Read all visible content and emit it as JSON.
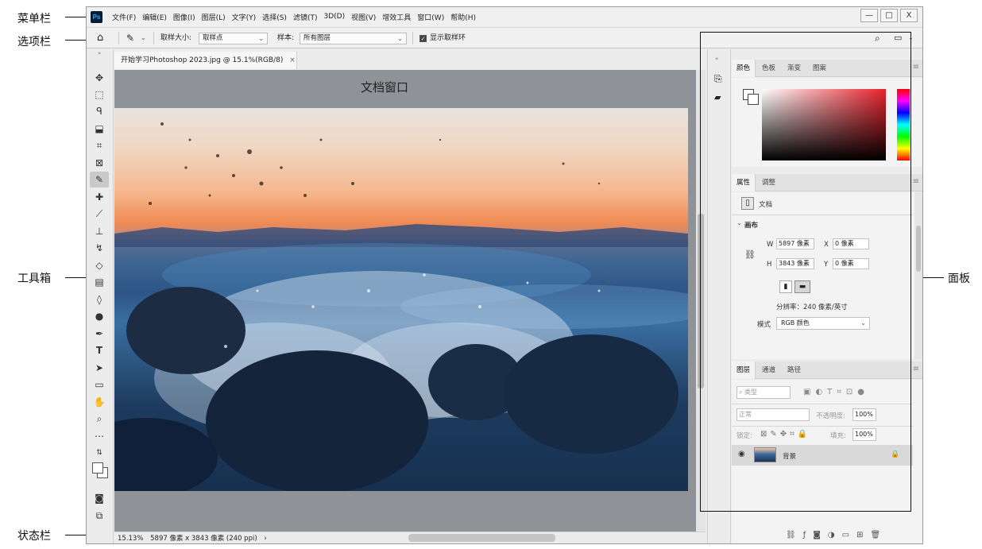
{
  "callouts": {
    "menubar": "菜单栏",
    "options": "选项栏",
    "toolbox": "工具箱",
    "statusbar": "状态栏",
    "panel": "面板"
  },
  "app": {
    "logo": "Ps",
    "menu": [
      "文件(F)",
      "编辑(E)",
      "图像(I)",
      "图层(L)",
      "文字(Y)",
      "选择(S)",
      "滤镜(T)",
      "3D(D)",
      "视图(V)",
      "增效工具",
      "窗口(W)",
      "帮助(H)"
    ],
    "window_controls": {
      "minimize": "—",
      "restore": "□",
      "close": "X"
    }
  },
  "options_bar": {
    "sample_size_label": "取样大小:",
    "sample_size_value": "取样点",
    "sample_label": "样本:",
    "sample_value": "所有图层",
    "show_ring_label": "显示取样环",
    "show_ring_checked": true
  },
  "document": {
    "tab_title": "开始学习Photoshop 2023.jpg @ 15.1%(RGB/8)",
    "tab_close": "×",
    "annotation": "文档窗口"
  },
  "status": {
    "zoom": "15.13%",
    "info": "5897 像素 x 3843 像素 (240 ppi)",
    "arrow": "›"
  },
  "color_panel": {
    "tabs": [
      "颜色",
      "色板",
      "渐变",
      "图案"
    ],
    "active_tab": 0,
    "hue_base": "#e8222c"
  },
  "properties_panel": {
    "tabs": [
      "属性",
      "调整"
    ],
    "doc_label": "文档",
    "canvas_section": "画布",
    "w_label": "W",
    "w_value": "5897 像素",
    "x_label": "X",
    "x_value": "0 像素",
    "h_label": "H",
    "h_value": "3843 像素",
    "y_label": "Y",
    "y_value": "0 像素",
    "resolution": "分辨率：240 像素/英寸",
    "mode_label": "模式",
    "mode_value": "RGB 颜色"
  },
  "layers_panel": {
    "tabs": [
      "图层",
      "通道",
      "路径"
    ],
    "filter_label": "类型",
    "blend_mode": "正常",
    "opacity_label": "不透明度:",
    "opacity_value": "100%",
    "lock_label": "锁定:",
    "fill_label": "填充:",
    "fill_value": "100%",
    "layer_name": "背景"
  }
}
